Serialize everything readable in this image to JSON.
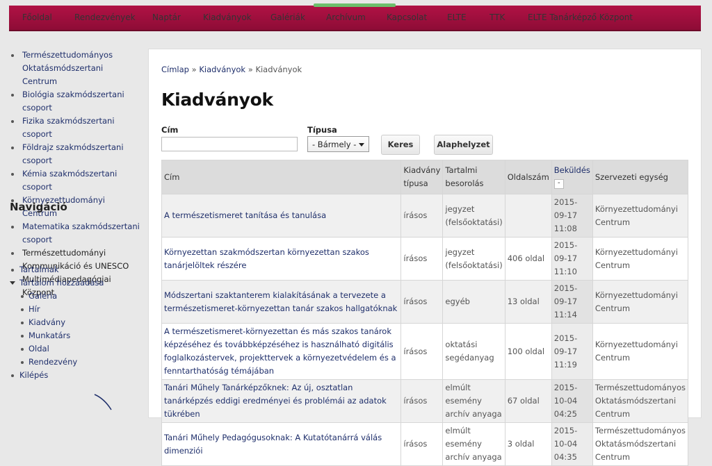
{
  "topnav": {
    "items": [
      "Főoldal",
      "Rendezvények",
      "Naptár",
      "Kiadványok",
      "Galériák",
      "Archívum",
      "Kapcsolat",
      "ELTE",
      "TTK",
      "ELTE Tanárképző Központ"
    ]
  },
  "sidebar": {
    "groups": [
      "Természettudományos Oktatásmódszertani Centrum",
      "Biológia szakmódszertani csoport",
      "Fizika szakmódszertani csoport",
      "Földrajz szakmódszertani csoport",
      "Kémia szakmódszertani csoport",
      "Környezettudományi Centrum",
      "Matematika szakmódszertani csoport",
      "Természettudományi Kommunikáció és UNESCO Multimédiapedagógiai Központ"
    ],
    "nav_title": "Navigáció",
    "nav": {
      "tartalmak": "Tartalmak",
      "tartalom_hozzaadasa": "Tartalom hozzáadása",
      "sub": [
        "Galéria",
        "Hír",
        "Kiadvány",
        "Munkatárs",
        "Oldal",
        "Rendezvény"
      ],
      "kilepes": "Kilépés"
    }
  },
  "main": {
    "breadcrumb": {
      "home": "Címlap",
      "sep": "»",
      "mid": "Kiadványok",
      "current": "Kiadványok"
    },
    "title": "Kiadványok",
    "filters": {
      "title_label": "Cím",
      "title_value": "",
      "type_label": "Típusa",
      "type_selected": "- Bármely -",
      "search_button": "Keres",
      "reset_button": "Alaphelyzet"
    },
    "table": {
      "headers": {
        "title": "Cím",
        "type": "Kiadvány típusa",
        "class": "Tartalmi besorolás",
        "pages": "Oldalszám",
        "submitted": "Beküldés",
        "sort": "-",
        "unit": "Szervezeti egység"
      },
      "rows": [
        [
          "A természetismeret tanítása és tanulása",
          "írásos",
          "jegyzet (felsőoktatási)",
          "",
          "2015-09-17 11:08",
          "Környezettudományi Centrum"
        ],
        [
          "Környezettan szakmódszertan környezettan szakos tanárjelöltek részére",
          "írásos",
          "jegyzet (felsőoktatási)",
          "406 oldal",
          "2015-09-17 11:10",
          "Környezettudományi Centrum"
        ],
        [
          "Módszertani szaktanterem kialakításának a tervezete a természetismeret-környezettan tanár szakos hallgatóknak",
          "írásos",
          "egyéb",
          "13 oldal",
          "2015-09-17 11:14",
          "Környezettudományi Centrum"
        ],
        [
          "A természetismeret-környezettan és más szakos tanárok képzéséhez és továbbképzéséhez is használható digitális foglalkozástervek, projekttervek a környezetvédelem és a fenntarthatóság témájában",
          "írásos",
          "oktatási segédanyag",
          "100 oldal",
          "2015-09-17 11:19",
          "Környezettudományi Centrum"
        ],
        [
          "Tanári Műhely Tanárképzőknek: Az új, osztatlan tanárképzés eddigi eredményei és problémái az adatok tükrében",
          "írásos",
          "elmúlt esemény archív anyaga",
          "67 oldal",
          "2015-10-04 04:25",
          "Természettudományos Oktatásmódszertani Centrum"
        ],
        [
          "Tanári Műhely Pedagógusoknak: A Kutatótanárrá válás dimenziói",
          "írásos",
          "elmúlt esemény archív anyaga",
          "3 oldal",
          "2015-10-04 04:35",
          "Természettudományos Oktatásmódszertani Centrum"
        ]
      ]
    }
  }
}
